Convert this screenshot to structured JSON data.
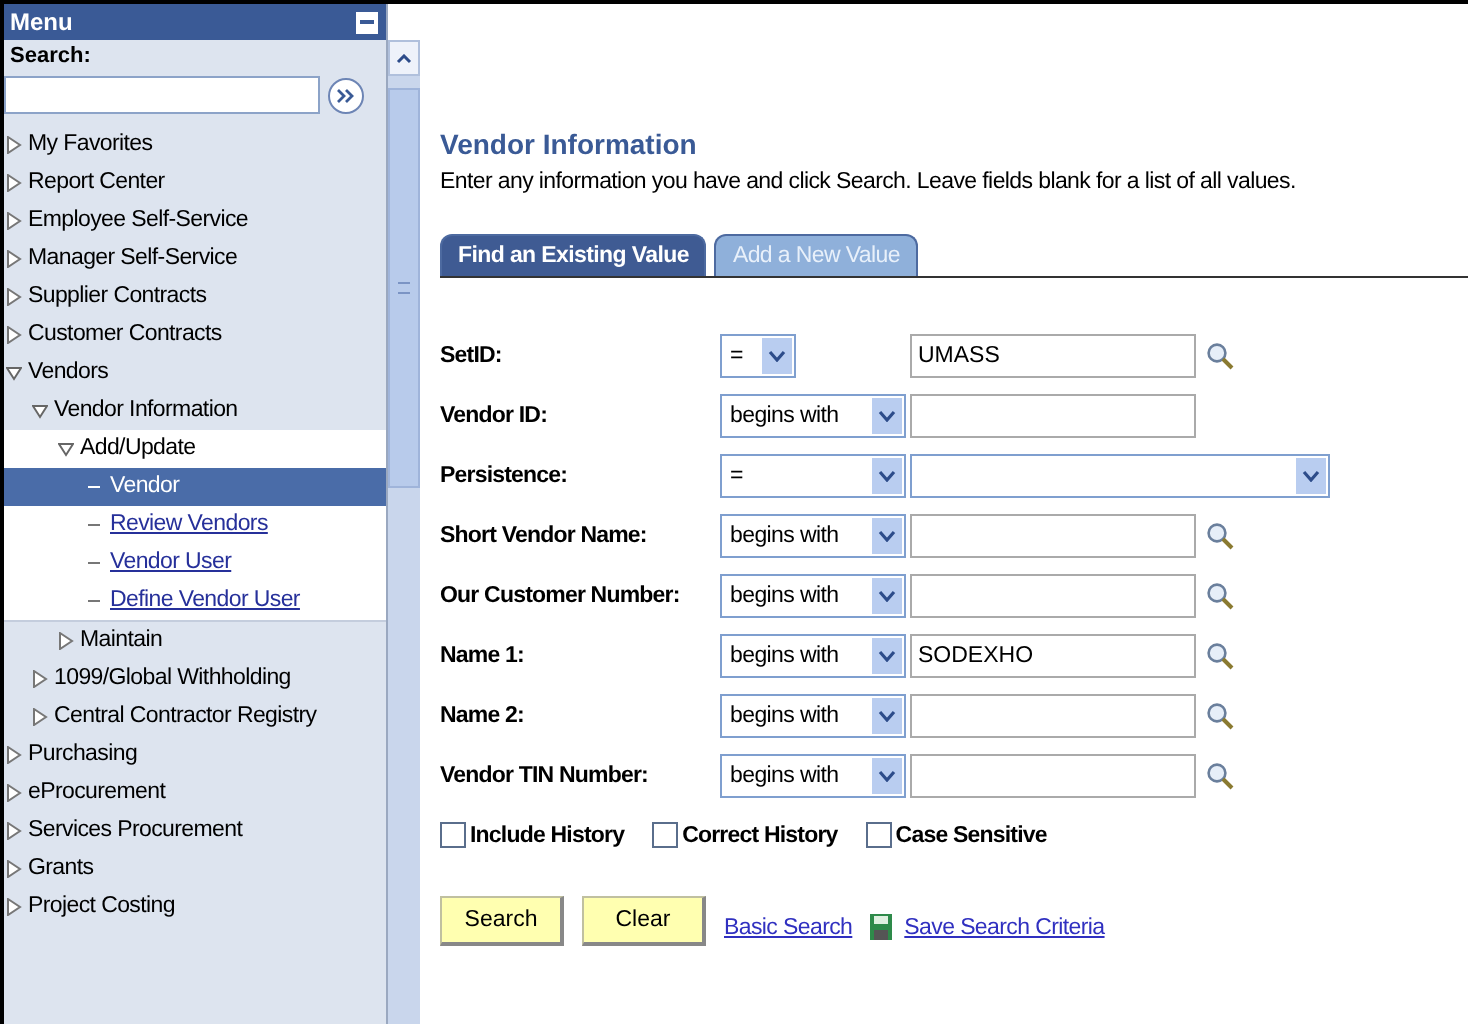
{
  "menu": {
    "title": "Menu",
    "search_label": "Search:",
    "items": [
      {
        "label": "My Favorites",
        "kind": "folder",
        "expanded": false
      },
      {
        "label": "Report Center",
        "kind": "folder",
        "expanded": false
      },
      {
        "label": "Employee Self-Service",
        "kind": "folder",
        "expanded": false
      },
      {
        "label": "Manager Self-Service",
        "kind": "folder",
        "expanded": false
      },
      {
        "label": "Supplier Contracts",
        "kind": "folder",
        "expanded": false
      },
      {
        "label": "Customer Contracts",
        "kind": "folder",
        "expanded": false
      },
      {
        "label": "Vendors",
        "kind": "folder",
        "expanded": true,
        "children": [
          {
            "label": "Vendor Information",
            "kind": "folder",
            "expanded": true,
            "children": [
              {
                "label": "Add/Update",
                "kind": "folder",
                "expanded": true,
                "children": [
                  {
                    "label": "Vendor",
                    "kind": "page",
                    "selected": true
                  },
                  {
                    "label": "Review Vendors",
                    "kind": "page",
                    "selected": false
                  },
                  {
                    "label": "Vendor User",
                    "kind": "page",
                    "selected": false
                  },
                  {
                    "label": "Define Vendor User",
                    "kind": "page",
                    "selected": false
                  }
                ]
              },
              {
                "label": "Maintain",
                "kind": "folder",
                "expanded": false
              }
            ]
          },
          {
            "label": "1099/Global Withholding",
            "kind": "folder",
            "expanded": false
          },
          {
            "label": "Central Contractor Registry",
            "kind": "folder",
            "expanded": false
          }
        ]
      },
      {
        "label": "Purchasing",
        "kind": "folder",
        "expanded": false
      },
      {
        "label": "eProcurement",
        "kind": "folder",
        "expanded": false
      },
      {
        "label": "Services Procurement",
        "kind": "folder",
        "expanded": false
      },
      {
        "label": "Grants",
        "kind": "folder",
        "expanded": false
      },
      {
        "label": "Project Costing",
        "kind": "folder",
        "expanded": false
      }
    ]
  },
  "page": {
    "title": "Vendor Information",
    "instructions": "Enter any information you have and click Search. Leave fields blank for a list of all values.",
    "tabs": [
      {
        "label": "Find an Existing Value",
        "selected": true
      },
      {
        "label": "Add a New Value",
        "selected": false
      }
    ],
    "fields": [
      {
        "label": "SetID:",
        "operator": "=",
        "operator_wide": false,
        "kind": "text",
        "value": "UMASS",
        "lookup": true
      },
      {
        "label": "Vendor ID:",
        "operator": "begins with",
        "operator_wide": true,
        "kind": "text",
        "lookup": false
      },
      {
        "label": "Persistence:",
        "operator": "=",
        "operator_wide": true,
        "kind": "select",
        "lookup": false
      },
      {
        "label": "Short Vendor Name:",
        "operator": "begins with",
        "operator_wide": true,
        "kind": "text",
        "lookup": true
      },
      {
        "label": "Our Customer Number:",
        "operator": "begins with",
        "operator_wide": true,
        "kind": "text",
        "lookup": true
      },
      {
        "label": "Name 1:",
        "operator": "begins with",
        "operator_wide": true,
        "kind": "text",
        "value": "SODEXHO",
        "lookup": true
      },
      {
        "label": "Name 2:",
        "operator": "begins with",
        "operator_wide": true,
        "kind": "text",
        "lookup": true
      },
      {
        "label": "Vendor TIN Number:",
        "operator": "begins with",
        "operator_wide": true,
        "kind": "text",
        "lookup": true
      }
    ],
    "options": [
      {
        "label": "Include History",
        "checked": false
      },
      {
        "label": "Correct History",
        "checked": false
      },
      {
        "label": "Case Sensitive",
        "checked": false
      }
    ],
    "buttons": [
      "Search",
      "Clear"
    ],
    "links": [
      {
        "label": "Basic Search",
        "icon": false
      },
      {
        "label": "Save Search Criteria",
        "icon": true
      }
    ]
  }
}
